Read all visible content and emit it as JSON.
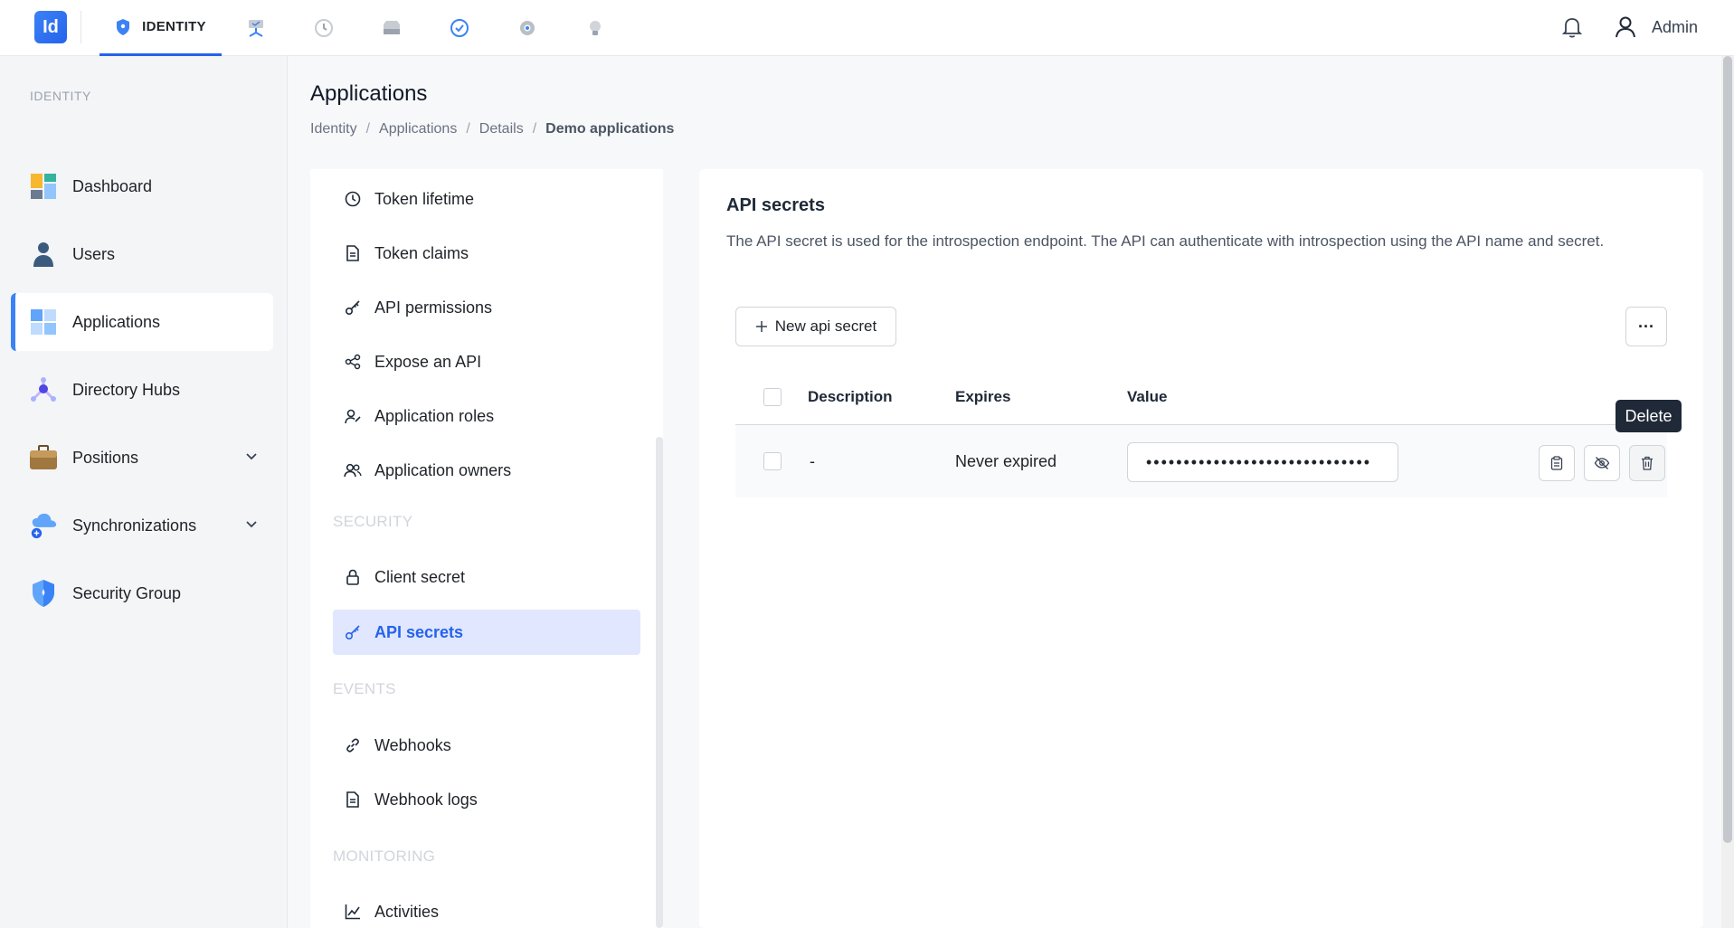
{
  "topbar": {
    "logo_text": "Id",
    "active_tab_label": "IDENTITY",
    "tabs": [
      {
        "icon": "shield-icon",
        "label": "IDENTITY",
        "active": true
      },
      {
        "icon": "network-icon"
      },
      {
        "icon": "history-icon"
      },
      {
        "icon": "storage-icon"
      },
      {
        "icon": "badge-check-icon"
      },
      {
        "icon": "settings-icon"
      },
      {
        "icon": "lightbulb-icon"
      }
    ],
    "user_name": "Admin"
  },
  "sidebar": {
    "heading": "IDENTITY",
    "items": [
      {
        "label": "Dashboard",
        "icon": "dashboard-icon"
      },
      {
        "label": "Users",
        "icon": "user-icon"
      },
      {
        "label": "Applications",
        "icon": "applications-icon",
        "active": true
      },
      {
        "label": "Directory Hubs",
        "icon": "directory-hub-icon"
      },
      {
        "label": "Positions",
        "icon": "briefcase-icon",
        "expandable": true
      },
      {
        "label": "Synchronizations",
        "icon": "cloud-sync-icon",
        "expandable": true
      },
      {
        "label": "Security Group",
        "icon": "security-shield-icon"
      }
    ]
  },
  "page": {
    "title": "Applications",
    "breadcrumb": [
      "Identity",
      "Applications",
      "Details",
      "Demo applications"
    ]
  },
  "subnav": {
    "items": [
      {
        "label": "Token lifetime",
        "icon": "clock-icon"
      },
      {
        "label": "Token claims",
        "icon": "document-icon"
      },
      {
        "label": "API permissions",
        "icon": "key-icon"
      },
      {
        "label": "Expose an API",
        "icon": "share-icon"
      },
      {
        "label": "Application roles",
        "icon": "user-role-icon"
      },
      {
        "label": "Application owners",
        "icon": "users-icon"
      }
    ],
    "security_heading": "SECURITY",
    "security_items": [
      {
        "label": "Client secret",
        "icon": "lock-icon"
      },
      {
        "label": "API secrets",
        "icon": "key-icon",
        "active": true
      }
    ],
    "events_heading": "EVENTS",
    "events_items": [
      {
        "label": "Webhooks",
        "icon": "link-icon"
      },
      {
        "label": "Webhook logs",
        "icon": "document-icon"
      }
    ],
    "monitoring_heading": "MONITORING",
    "monitoring_items": [
      {
        "label": "Activities",
        "icon": "chart-icon"
      }
    ]
  },
  "panel": {
    "title": "API secrets",
    "description": "The API secret is used for the introspection endpoint. The API can authenticate with introspection using the API name and secret.",
    "new_button_label": "New api secret",
    "more_button_label": "···",
    "table": {
      "columns": [
        "Description",
        "Expires",
        "Value"
      ],
      "rows": [
        {
          "description": "-",
          "expires": "Never expired",
          "value": "••••••••••••••••••••••••••••••"
        }
      ]
    },
    "tooltip": "Delete"
  },
  "colors": {
    "accent": "#2563eb",
    "active_bg": "#e0e7ff",
    "sidebar_bg": "#f4f5f7"
  }
}
